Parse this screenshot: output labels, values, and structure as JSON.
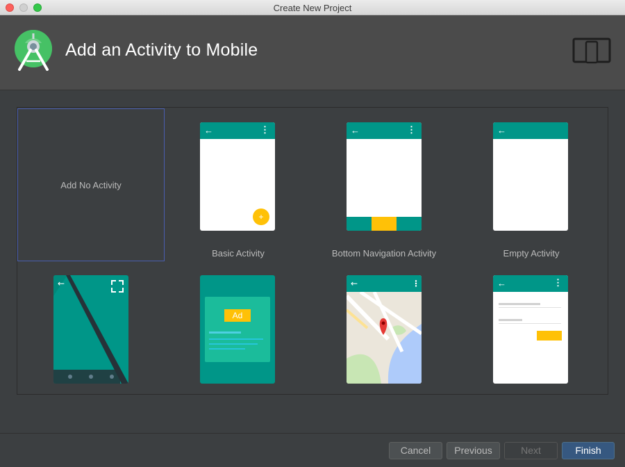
{
  "window": {
    "title": "Create New Project"
  },
  "header": {
    "title": "Add an Activity to Mobile"
  },
  "templates": [
    {
      "label": "Add No Activity"
    },
    {
      "label": "Basic Activity"
    },
    {
      "label": "Bottom Navigation Activity"
    },
    {
      "label": "Empty Activity"
    }
  ],
  "ad_badge": "Ad",
  "footer": {
    "cancel": "Cancel",
    "previous": "Previous",
    "next": "Next",
    "finish": "Finish"
  },
  "colors": {
    "teal": "#009688",
    "amber": "#ffc107",
    "selection_border": "#4a5fb0",
    "primary_button": "#365880"
  },
  "icons": {
    "logo": "android-studio-logo",
    "device": "phone-tablet-icon",
    "back": "back-arrow-icon",
    "overflow": "overflow-menu-icon",
    "fab": "fab-plus-icon",
    "fullscreen": "fullscreen-icon",
    "map_marker": "map-pin-icon"
  }
}
